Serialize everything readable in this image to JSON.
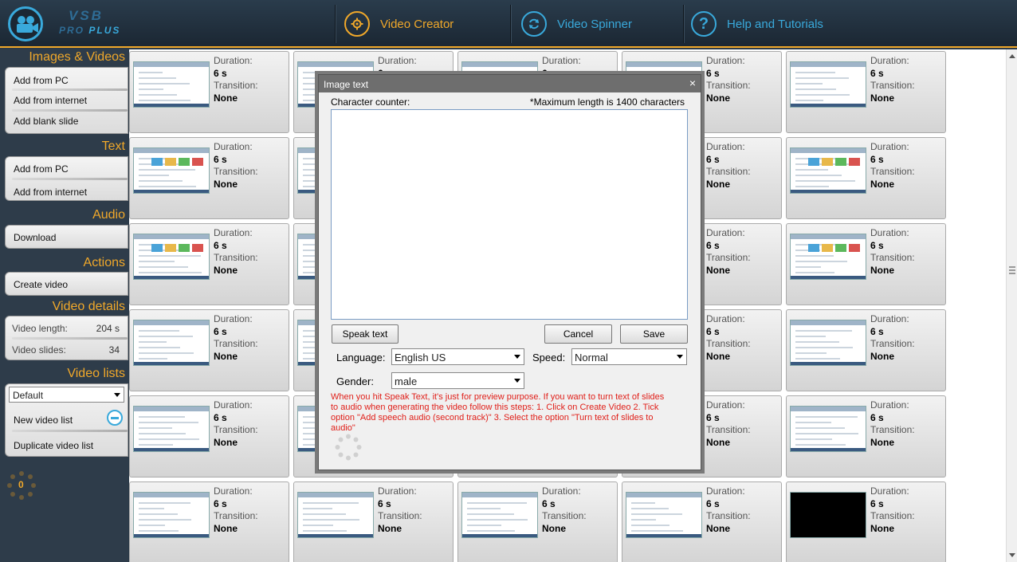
{
  "header": {
    "brand_line1": "VSB",
    "brand_line2a": "PRO",
    "brand_line2b": "PLUS",
    "nav": [
      {
        "label": "Video Creator",
        "color": "#f0a82a"
      },
      {
        "label": "Video Spinner",
        "color": "#39a9db"
      },
      {
        "label": "Help and Tutorials",
        "color": "#39a9db"
      }
    ]
  },
  "sidebar": {
    "images_title": "Images & Videos",
    "images_items": [
      "Add from PC",
      "Add from internet",
      "Add blank slide"
    ],
    "text_title": "Text",
    "text_items": [
      "Add from PC",
      "Add from internet"
    ],
    "audio_title": "Audio",
    "audio_items": [
      "Download"
    ],
    "actions_title": "Actions",
    "actions_items": [
      "Create video"
    ],
    "details_title": "Video details",
    "video_length_label": "Video length:",
    "video_length_value": "204 s",
    "video_slides_label": "Video slides:",
    "video_slides_value": "34",
    "lists_title": "Video lists",
    "list_selected": "Default",
    "new_list": "New video list",
    "duplicate_list": "Duplicate video list",
    "counter": "0"
  },
  "slides": {
    "duration_label": "Duration:",
    "transition_label": "Transition:",
    "duration_value": "6 s",
    "transition_value": "None"
  },
  "modal": {
    "title": "Image text",
    "close": "×",
    "char_counter": "Character counter:",
    "max_length": "*Maximum length is 1400 characters",
    "speak_text": "Speak text",
    "cancel": "Cancel",
    "save": "Save",
    "language_label": "Language:",
    "language_value": "English US",
    "speed_label": "Speed:",
    "speed_value": "Normal",
    "gender_label": "Gender:",
    "gender_value": "male",
    "warning": "When you hit Speak Text, it's just for preview purpose. If you want to turn text of slides to audio when generating the video follow this steps: 1. Click on Create Video 2. Tick option \"Add speech audio (second track)\" 3. Select the option \"Turn text of slides to audio\""
  }
}
